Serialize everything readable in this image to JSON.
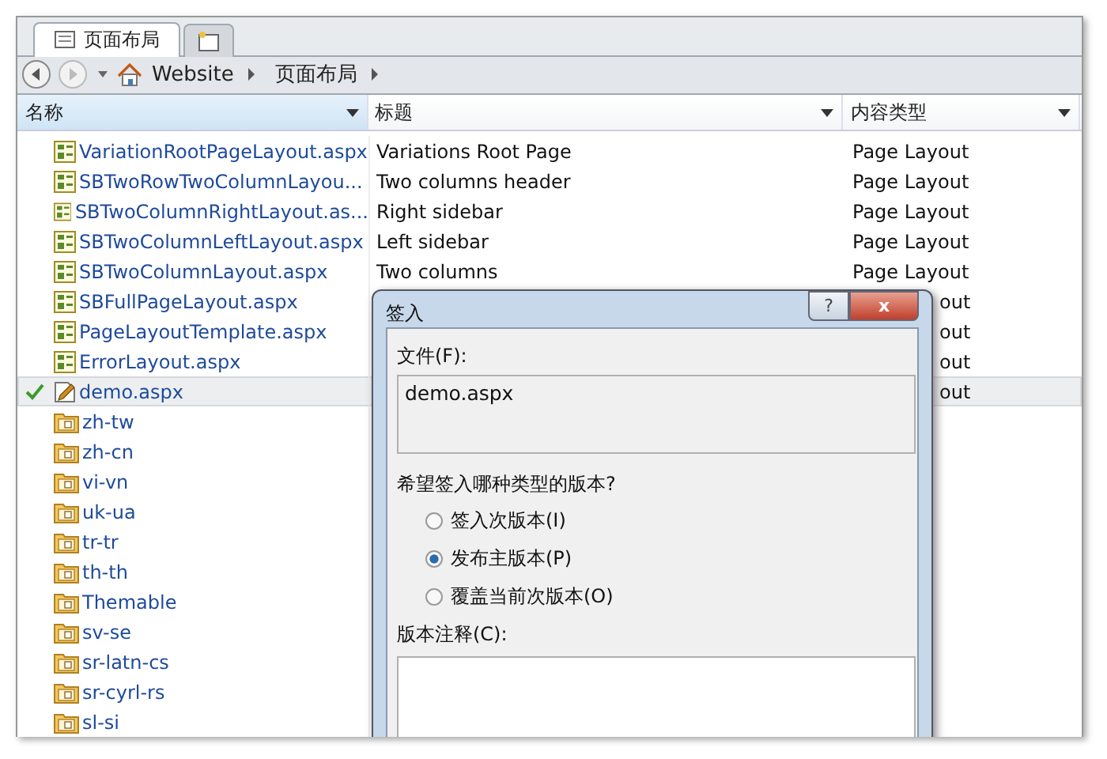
{
  "tabs": [
    {
      "label": "页面布局",
      "kind": "page",
      "selected": true
    },
    {
      "kind": "new",
      "selected": false
    }
  ],
  "breadcrumb": [
    "Website",
    "页面布局"
  ],
  "table": {
    "columns": [
      "名称",
      "标题",
      "内容类型"
    ],
    "rows": [
      {
        "kind": "layout",
        "name": "VariationRootPageLayout.aspx",
        "title": "Variations Root Page",
        "content_type": "Page Layout",
        "selected": false,
        "checked_out": false
      },
      {
        "kind": "layout",
        "name": "SBTwoRowTwoColumnLayou...",
        "title": "Two columns header",
        "content_type": "Page Layout",
        "selected": false,
        "checked_out": false
      },
      {
        "kind": "layout",
        "name": "SBTwoColumnRightLayout.as...",
        "title": "Right sidebar",
        "content_type": "Page Layout",
        "selected": false,
        "checked_out": false
      },
      {
        "kind": "layout",
        "name": "SBTwoColumnLeftLayout.aspx",
        "title": "Left sidebar",
        "content_type": "Page Layout",
        "selected": false,
        "checked_out": false
      },
      {
        "kind": "layout",
        "name": "SBTwoColumnLayout.aspx",
        "title": "Two columns",
        "content_type": "Page Layout",
        "selected": false,
        "checked_out": false
      },
      {
        "kind": "layout",
        "name": "SBFullPageLayout.aspx",
        "content_type": "out",
        "selected": false,
        "checked_out": false
      },
      {
        "kind": "layout",
        "name": "PageLayoutTemplate.aspx",
        "content_type": "out",
        "selected": false,
        "checked_out": false
      },
      {
        "kind": "layout",
        "name": "ErrorLayout.aspx",
        "content_type": "out",
        "selected": false,
        "checked_out": false
      },
      {
        "kind": "file",
        "name": "demo.aspx",
        "content_type": "out",
        "selected": true,
        "checked_out": true
      },
      {
        "kind": "folder",
        "name": "zh-tw",
        "selected": false,
        "checked_out": false
      },
      {
        "kind": "folder",
        "name": "zh-cn",
        "selected": false,
        "checked_out": false
      },
      {
        "kind": "folder",
        "name": "vi-vn",
        "selected": false,
        "checked_out": false
      },
      {
        "kind": "folder",
        "name": "uk-ua",
        "selected": false,
        "checked_out": false
      },
      {
        "kind": "folder",
        "name": "tr-tr",
        "selected": false,
        "checked_out": false
      },
      {
        "kind": "folder",
        "name": "th-th",
        "selected": false,
        "checked_out": false
      },
      {
        "kind": "folder",
        "name": "Themable",
        "selected": false,
        "checked_out": false
      },
      {
        "kind": "folder",
        "name": "sv-se",
        "selected": false,
        "checked_out": false
      },
      {
        "kind": "folder",
        "name": "sr-latn-cs",
        "selected": false,
        "checked_out": false
      },
      {
        "kind": "folder",
        "name": "sr-cyrl-rs",
        "selected": false,
        "checked_out": false
      },
      {
        "kind": "folder",
        "name": "sl-si",
        "selected": false,
        "checked_out": false
      }
    ]
  },
  "dialog": {
    "title": "签入",
    "help": "?",
    "close": "x",
    "file_label": "文件(F):",
    "file_value": "demo.aspx",
    "question": "希望签入哪种类型的版本?",
    "options": [
      {
        "label": "签入次版本(I)",
        "selected": false
      },
      {
        "label": "发布主版本(P)",
        "selected": true
      },
      {
        "label": "覆盖当前次版本(O)",
        "selected": false
      }
    ],
    "comment_label": "版本注释(C):"
  }
}
